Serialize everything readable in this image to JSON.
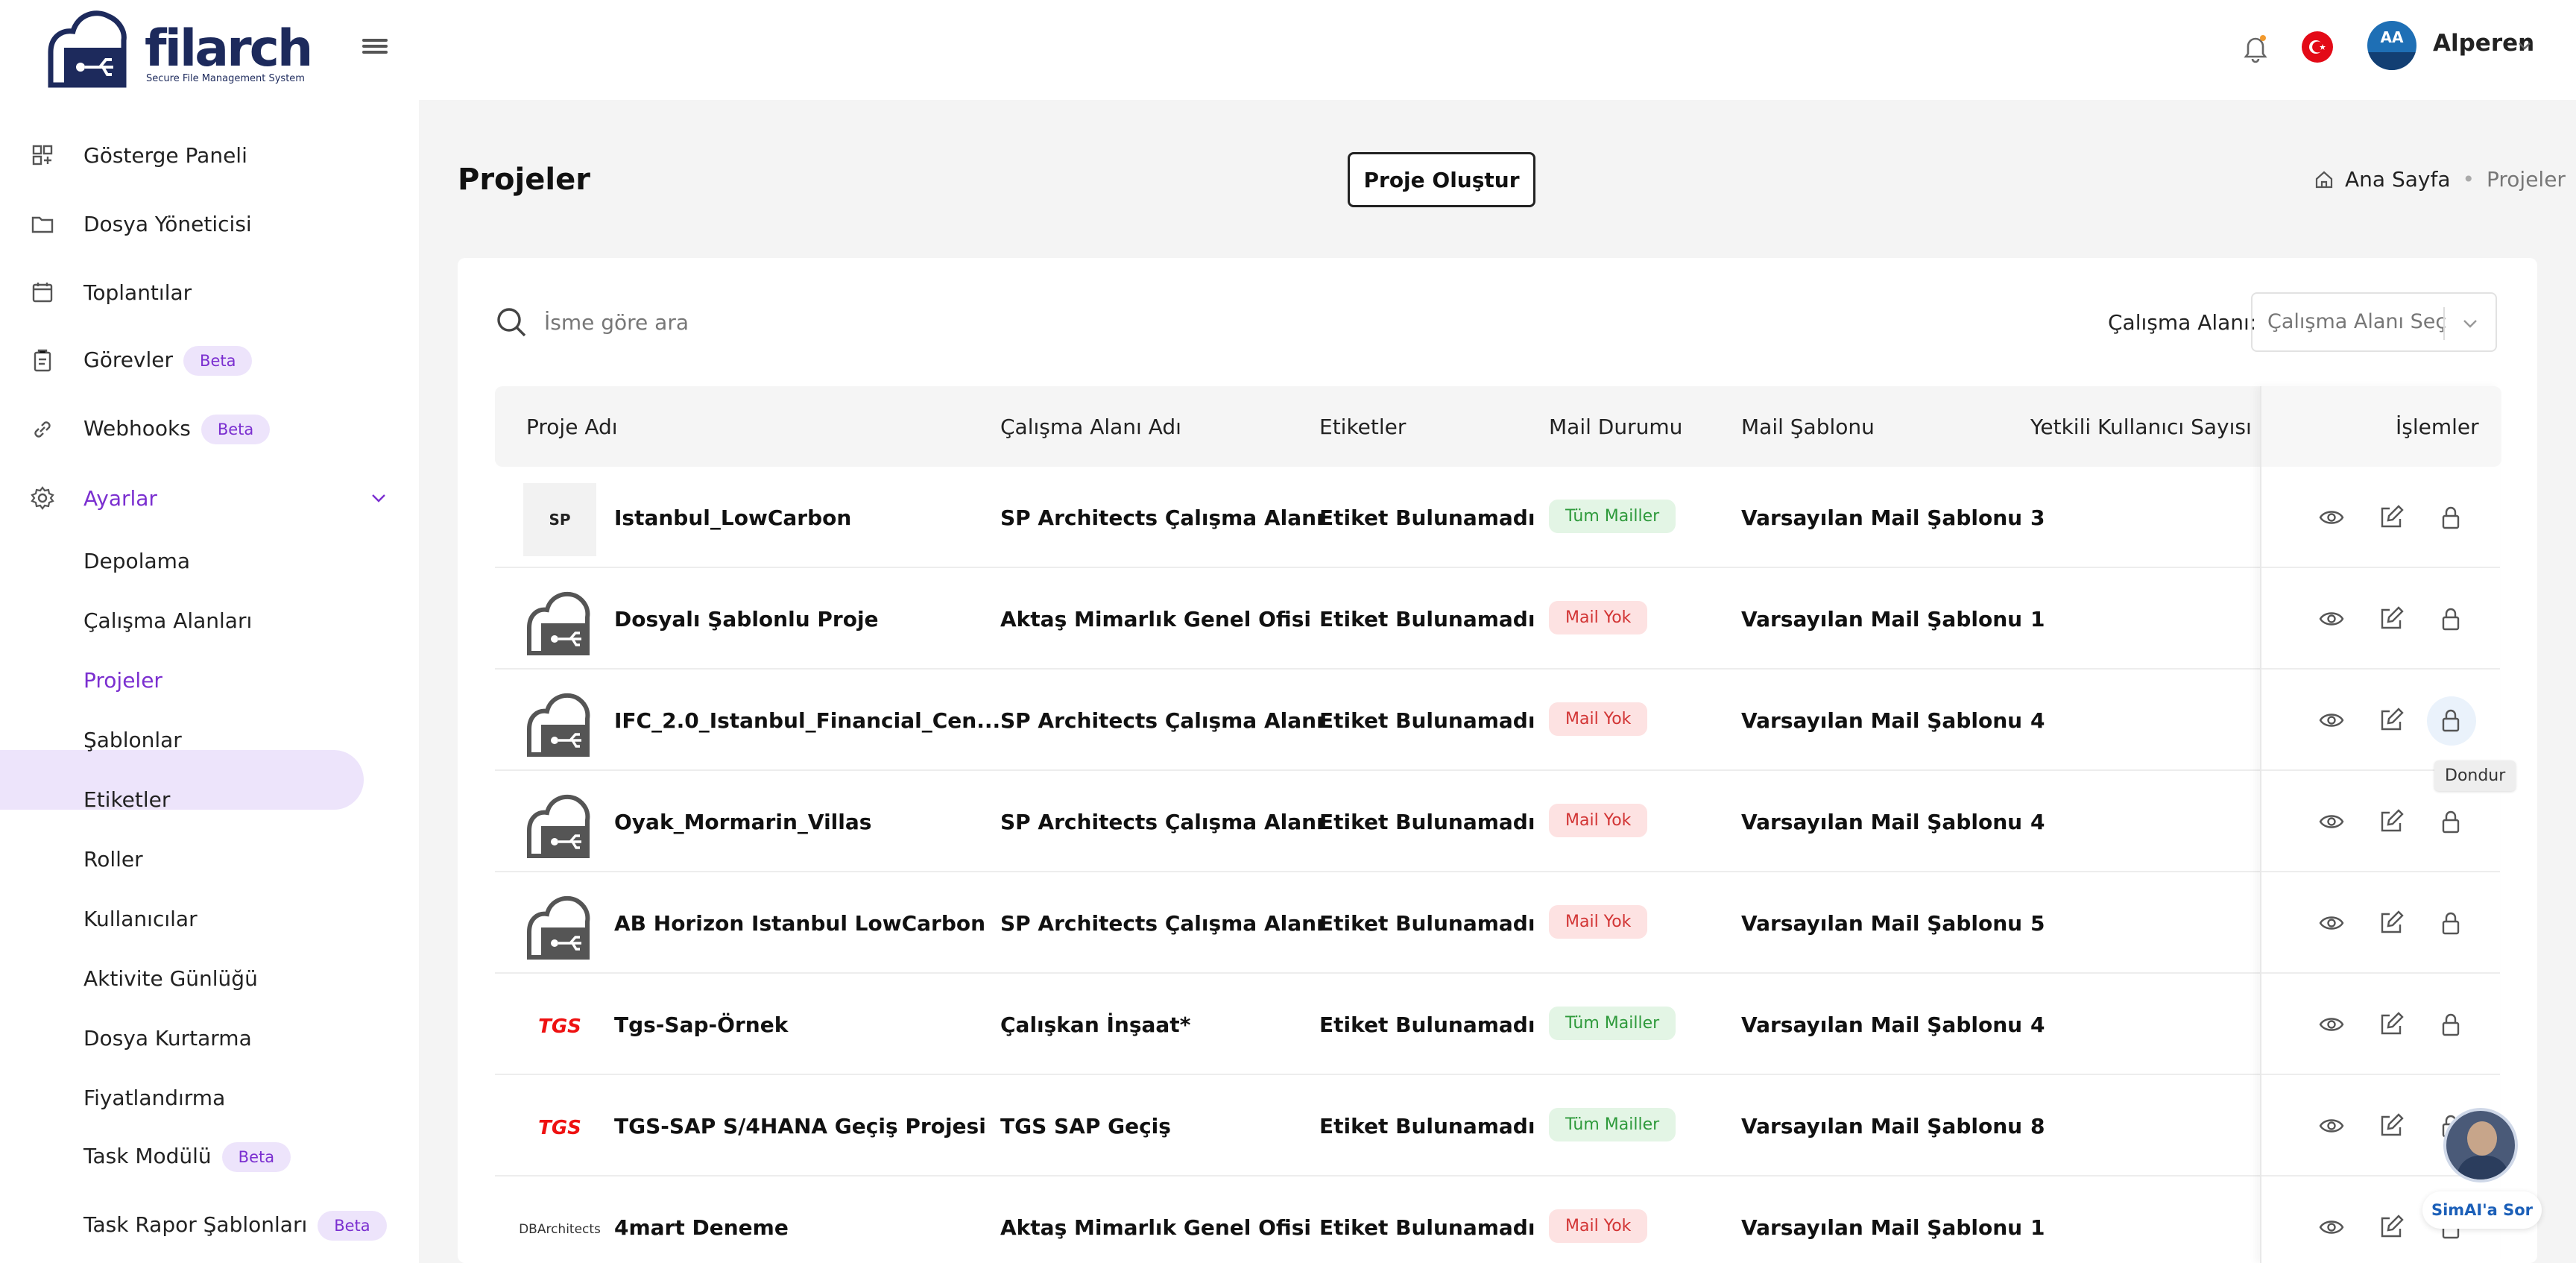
{
  "app": {
    "logo_text": "filarch",
    "logo_subtitle": "Secure File Management System"
  },
  "header": {
    "avatar_initials": "AA",
    "user_name": "Alperen"
  },
  "sidebar": {
    "items": [
      {
        "label": "Gösterge Paneli",
        "icon": "dashboard-icon"
      },
      {
        "label": "Dosya Yöneticisi",
        "icon": "folder-icon"
      },
      {
        "label": "Toplantılar",
        "icon": "calendar-icon"
      },
      {
        "label": "Görevler",
        "icon": "clipboard-icon",
        "badge": "Beta"
      },
      {
        "label": "Webhooks",
        "icon": "link-icon",
        "badge": "Beta"
      },
      {
        "label": "Ayarlar",
        "icon": "gear-icon",
        "expanded": true
      }
    ],
    "sub_items": [
      {
        "label": "Depolama"
      },
      {
        "label": "Çalışma Alanları"
      },
      {
        "label": "Projeler",
        "active": true
      },
      {
        "label": "Şablonlar"
      },
      {
        "label": "Etiketler"
      },
      {
        "label": "Roller"
      },
      {
        "label": "Kullanıcılar"
      },
      {
        "label": "Aktivite Günlüğü"
      },
      {
        "label": "Dosya Kurtarma"
      },
      {
        "label": "Fiyatlandırma"
      },
      {
        "label": "Task Modülü",
        "badge": "Beta"
      },
      {
        "label": "Task Rapor Şablonları",
        "badge": "Beta"
      }
    ],
    "accent_color": "#7b2fd0"
  },
  "page": {
    "title": "Projeler",
    "create_button": "Proje Oluştur",
    "breadcrumb": {
      "home": "Ana Sayfa",
      "current": "Projeler"
    }
  },
  "filters": {
    "search_placeholder": "İsme göre ara",
    "workspace_label": "Çalışma Alanı:",
    "workspace_select": "Çalışma Alanı Seç"
  },
  "table": {
    "columns": [
      "Proje Adı",
      "Çalışma Alanı Adı",
      "Etiketler",
      "Mail Durumu",
      "Mail Şablonu",
      "Yetkili Kullanıcı Sayısı",
      "İşlemler"
    ],
    "rows": [
      {
        "thumb": "sp",
        "thumb_text": "SP",
        "name": "Istanbul_LowCarbon",
        "workspace": "SP Architects Çalışma Alanı",
        "tags": "Etiket Bulunamadı",
        "mail_status": "Tüm Mailler",
        "mail_status_kind": "green",
        "mail_template": "Varsayılan Mail Şablonu",
        "users": "3"
      },
      {
        "thumb": "cloud",
        "thumb_text": "",
        "name": "Dosyalı Şablonlu Proje",
        "workspace": "Aktaş Mimarlık Genel Ofisi",
        "tags": "Etiket Bulunamadı",
        "mail_status": "Mail Yok",
        "mail_status_kind": "red",
        "mail_template": "Varsayılan Mail Şablonu",
        "users": "1"
      },
      {
        "thumb": "cloud",
        "thumb_text": "",
        "name": "IFC_2.0_Istanbul_Financial_Cen...",
        "workspace": "SP Architects Çalışma Alanı",
        "tags": "Etiket Bulunamadı",
        "mail_status": "Mail Yok",
        "mail_status_kind": "red",
        "mail_template": "Varsayılan Mail Şablonu",
        "users": "4"
      },
      {
        "thumb": "cloud",
        "thumb_text": "",
        "name": "Oyak_Mormarin_Villas",
        "workspace": "SP Architects Çalışma Alanı",
        "tags": "Etiket Bulunamadı",
        "mail_status": "Mail Yok",
        "mail_status_kind": "red",
        "mail_template": "Varsayılan Mail Şablonu",
        "users": "4"
      },
      {
        "thumb": "cloud",
        "thumb_text": "",
        "name": "AB Horizon Istanbul LowCarbon",
        "workspace": "SP Architects Çalışma Alanı",
        "tags": "Etiket Bulunamadı",
        "mail_status": "Mail Yok",
        "mail_status_kind": "red",
        "mail_template": "Varsayılan Mail Şablonu",
        "users": "5"
      },
      {
        "thumb": "tgs",
        "thumb_text": "TGS",
        "name": "Tgs-Sap-Örnek",
        "workspace": "Çalışkan İnşaat*",
        "tags": "Etiket Bulunamadı",
        "mail_status": "Tüm Mailler",
        "mail_status_kind": "green",
        "mail_template": "Varsayılan Mail Şablonu",
        "users": "4"
      },
      {
        "thumb": "tgs",
        "thumb_text": "TGS",
        "name": "TGS-SAP S/4HANA Geçiş Projesi",
        "workspace": "TGS SAP Geçiş",
        "tags": "Etiket Bulunamadı",
        "mail_status": "Tüm Mailler",
        "mail_status_kind": "green",
        "mail_template": "Varsayılan Mail Şablonu",
        "users": "8"
      },
      {
        "thumb": "db",
        "thumb_text": "DBArchitects",
        "name": "4mart Deneme",
        "workspace": "Aktaş Mimarlık Genel Ofisi",
        "tags": "Etiket Bulunamadı",
        "mail_status": "Mail Yok",
        "mail_status_kind": "red",
        "mail_template": "Varsayılan Mail Şablonu",
        "users": "1"
      }
    ],
    "row_actions": [
      "eye-icon",
      "edit-icon",
      "lock-icon"
    ]
  },
  "tooltip": {
    "text": "Dondur"
  },
  "assistant": {
    "label": "SimAI'a Sor"
  }
}
